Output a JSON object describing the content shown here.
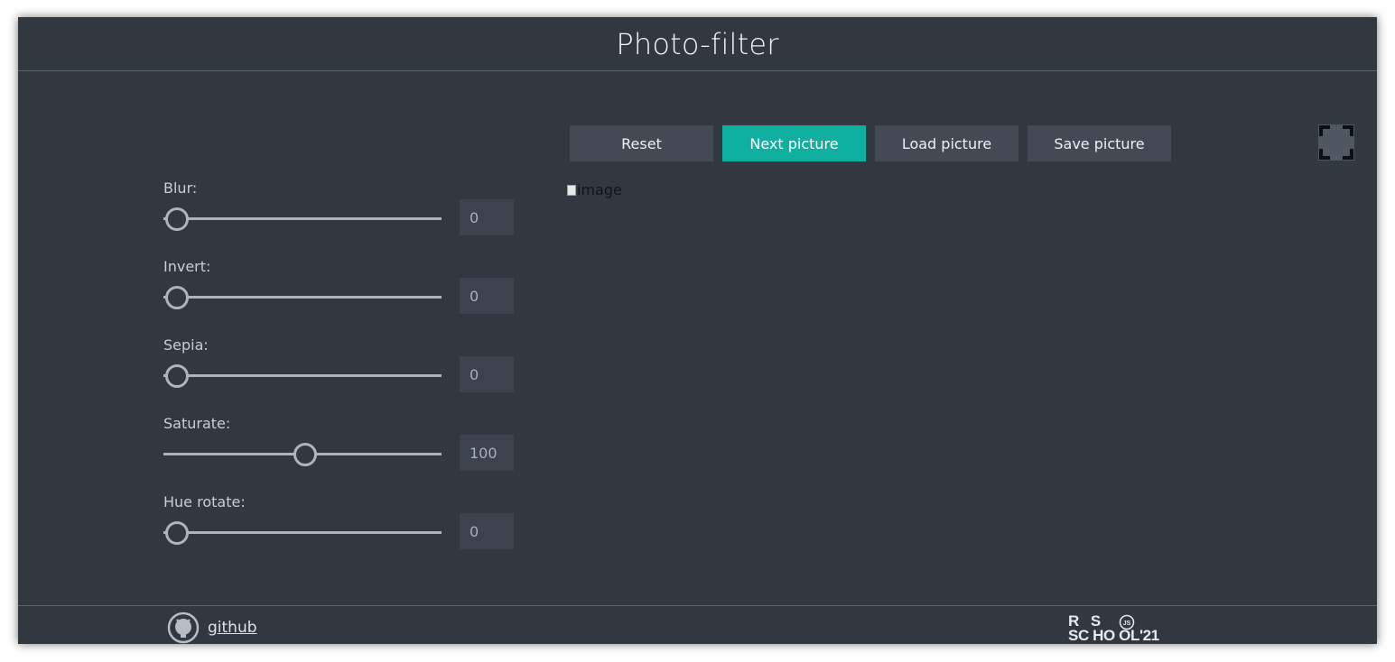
{
  "header": {
    "title": "Photo-filter"
  },
  "filters": [
    {
      "label": "Blur:",
      "value": "0",
      "fraction": 0.0
    },
    {
      "label": "Invert:",
      "value": "0",
      "fraction": 0.0
    },
    {
      "label": "Sepia:",
      "value": "0",
      "fraction": 0.0
    },
    {
      "label": "Saturate:",
      "value": "100",
      "fraction": 0.5
    },
    {
      "label": "Hue rotate:",
      "value": "0",
      "fraction": 0.0
    }
  ],
  "toolbar": {
    "reset_label": "Reset",
    "next_label": "Next picture",
    "load_label": "Load picture",
    "save_label": "Save picture"
  },
  "image": {
    "alt": "image"
  },
  "footer": {
    "github_label": "github",
    "logo_line1": "R   S",
    "logo_badge": "JS",
    "logo_line2": "SC HO OL'21"
  },
  "colors": {
    "background": "#313840",
    "accent": "#10b0a1",
    "button": "#434a53",
    "input": "#3c434c"
  },
  "icons": {
    "fullscreen": "fullscreen-icon",
    "github": "github-icon"
  }
}
